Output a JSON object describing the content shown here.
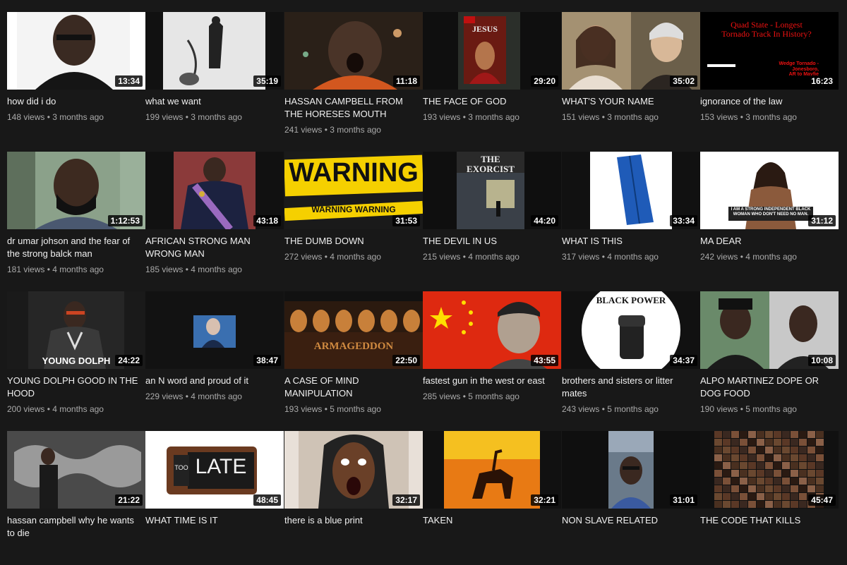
{
  "videos": [
    {
      "title": "how did i do",
      "views": "148 views",
      "age": "3 months ago",
      "duration": "13:34",
      "thumb_icon": "bald-man-portrait"
    },
    {
      "title": "what we want",
      "views": "199 views",
      "age": "3 months ago",
      "duration": "35:19",
      "thumb_icon": "chained-prisoner-sketch"
    },
    {
      "title": "HASSAN CAMPBELL FROM THE HORESES MOUTH",
      "views": "241 views",
      "age": "3 months ago",
      "duration": "11:18",
      "thumb_icon": "man-shouting-dark"
    },
    {
      "title": "THE FACE OF GOD",
      "views": "193 views",
      "age": "3 months ago",
      "duration": "29:20",
      "thumb_icon": "jesus-magazine-cover",
      "thumb_text": "JESUS"
    },
    {
      "title": "WHAT'S YOUR NAME",
      "views": "151 views",
      "age": "3 months ago",
      "duration": "35:02",
      "thumb_icon": "two-paintings"
    },
    {
      "title": "ignorance of the law",
      "views": "153 views",
      "age": "3 months ago",
      "duration": "16:23",
      "thumb_icon": "tornado-text",
      "thumb_text": "Quad State - Longest\nTornado Track In History?",
      "thumb_subtext": "Wedge Tornado - Jonesboro,\nAR to Mayfie"
    },
    {
      "title": "dr umar johson and the fear of the strong balck man",
      "views": "181 views",
      "age": "4 months ago",
      "duration": "1:12:53",
      "thumb_icon": "bearded-man-portrait"
    },
    {
      "title": "AFRICAN STRONG MAN WRONG MAN",
      "views": "185 views",
      "age": "4 months ago",
      "duration": "43:18",
      "thumb_icon": "uniformed-man-with-sash"
    },
    {
      "title": "THE DUMB DOWN",
      "views": "272 views",
      "age": "4 months ago",
      "duration": "31:53",
      "thumb_icon": "warning-tape",
      "thumb_text": "WARNING",
      "thumb_subtext": "WARNING WARNING"
    },
    {
      "title": "THE DEVIL IN US",
      "views": "215 views",
      "age": "4 months ago",
      "duration": "44:20",
      "thumb_icon": "exorcist-poster",
      "thumb_text": "THE EXORCIST"
    },
    {
      "title": "WHAT IS THIS",
      "views": "317 views",
      "age": "4 months ago",
      "duration": "33:34",
      "thumb_icon": "blue-bag"
    },
    {
      "title": "MA DEAR",
      "views": "242 views",
      "age": "4 months ago",
      "duration": "31:12",
      "thumb_icon": "woman-meme",
      "thumb_text": "I AM A STRONG INDEPENDENT BLACK\nWOMAN WHO DON'T NEED NO MAN."
    },
    {
      "title": "YOUNG DOLPH GOOD IN THE HOOD",
      "views": "200 views",
      "age": "4 months ago",
      "duration": "24:22",
      "thumb_icon": "rapper-portrait",
      "thumb_text": "YOUNG DOLPH"
    },
    {
      "title": "an N word and proud of it",
      "views": "229 views",
      "age": "4 months ago",
      "duration": "38:47",
      "thumb_icon": "dark-screen-man"
    },
    {
      "title": "A CASE OF MIND MANIPULATION",
      "views": "193 views",
      "age": "5 months ago",
      "duration": "22:50",
      "thumb_icon": "armageddon-poster",
      "thumb_text": "ARMAGEDDON"
    },
    {
      "title": "fastest gun in the west or east",
      "views": "285 views",
      "age": "5 months ago",
      "duration": "43:55",
      "thumb_icon": "flag-portrait"
    },
    {
      "title": "brothers and sisters or litter mates",
      "views": "243 views",
      "age": "5 months ago",
      "duration": "34:37",
      "thumb_icon": "black-power-fist",
      "thumb_text": "BLACK POWER"
    },
    {
      "title": "ALPO MARTINEZ DOPE OR DOG FOOD",
      "views": "190 views",
      "age": "5 months ago",
      "duration": "10:08",
      "thumb_icon": "two-man-portraits"
    },
    {
      "title": "hassan campbell why he wants to die",
      "views": "",
      "age": "",
      "duration": "21:22",
      "thumb_icon": "graffiti-wall"
    },
    {
      "title": "WHAT TIME IS IT",
      "views": "",
      "age": "",
      "duration": "48:45",
      "thumb_icon": "too-late-clock",
      "thumb_text": "LATE",
      "thumb_subtext": "TOO"
    },
    {
      "title": "there is a blue print",
      "views": "",
      "age": "",
      "duration": "32:17",
      "thumb_icon": "shocked-woman-face"
    },
    {
      "title": "TAKEN",
      "views": "",
      "age": "",
      "duration": "32:21",
      "thumb_icon": "end-of-trail-painting"
    },
    {
      "title": "NON SLAVE RELATED",
      "views": "",
      "age": "",
      "duration": "31:01",
      "thumb_icon": "man-in-car-selfie"
    },
    {
      "title": "THE CODE THAT KILLS",
      "views": "",
      "age": "",
      "duration": "45:47",
      "thumb_icon": "face-collage"
    }
  ],
  "colors": {
    "background": "#181818",
    "title": "#f1f1f1",
    "meta": "#aaaaaa"
  }
}
